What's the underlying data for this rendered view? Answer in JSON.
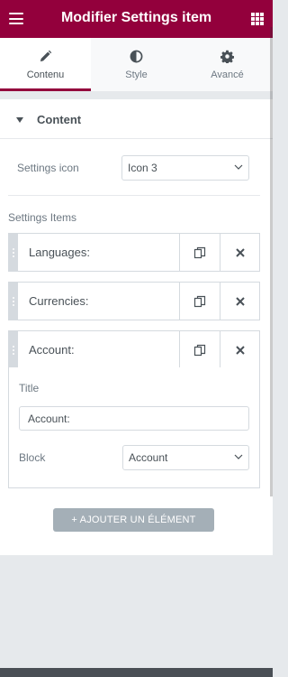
{
  "header": {
    "title": "Modifier Settings item",
    "menu_icon": "hamburger-icon",
    "apps_icon": "grid-icon"
  },
  "tabs": [
    {
      "label": "Contenu",
      "icon": "pencil-icon",
      "active": true
    },
    {
      "label": "Style",
      "icon": "half-circle-icon",
      "active": false
    },
    {
      "label": "Avancé",
      "icon": "gear-icon",
      "active": false
    }
  ],
  "section": {
    "title": "Content"
  },
  "settings_icon": {
    "label": "Settings icon",
    "value": "Icon 3"
  },
  "settings_items": {
    "label": "Settings Items",
    "rows": [
      {
        "title": "Languages:"
      },
      {
        "title": "Currencies:"
      },
      {
        "title": "Account:"
      }
    ]
  },
  "expanded_item": {
    "title_label": "Title",
    "title_value": "Account:",
    "block_label": "Block",
    "block_value": "Account"
  },
  "add_button": {
    "label": "+ AJOUTER UN ÉLÉMENT"
  },
  "colors": {
    "brand": "#93003c",
    "add_button": "#a4afb7",
    "border": "#d5dadf"
  }
}
